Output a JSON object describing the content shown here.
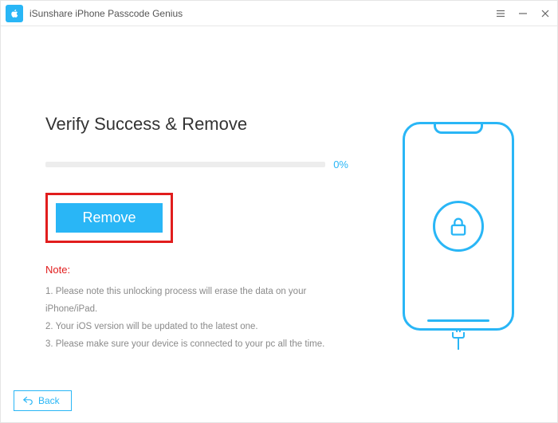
{
  "header": {
    "title": "iSunshare iPhone Passcode Genius"
  },
  "main": {
    "heading": "Verify Success & Remove",
    "progress_pct": "0%",
    "remove_label": "Remove",
    "note_title": "Note:",
    "notes": [
      "1. Please note this unlocking process will erase the data on your iPhone/iPad.",
      "2. Your iOS version will be updated to the latest one.",
      "3. Please make sure your device is connected to your pc all the time."
    ]
  },
  "footer": {
    "back_label": "Back"
  },
  "colors": {
    "accent": "#29b6f6",
    "danger": "#e11d1d"
  }
}
